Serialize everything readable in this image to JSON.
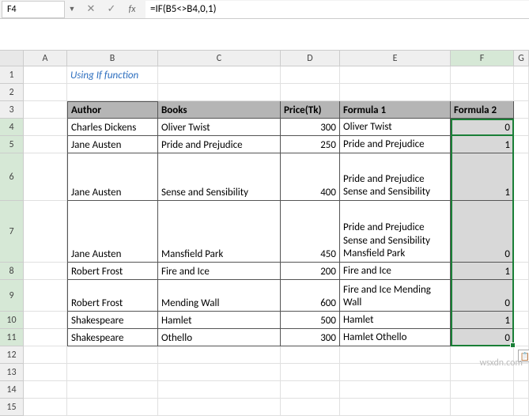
{
  "cell_ref": "F4",
  "formula": "=IF(B5<>B4,0,1)",
  "title": "Using If function",
  "columns": [
    "A",
    "B",
    "C",
    "D",
    "E",
    "F",
    "G"
  ],
  "headers": {
    "author": "Author",
    "books": "Books",
    "price": "Price(Tk)",
    "f1": "Formula 1",
    "f2": "Formula 2"
  },
  "rows": [
    {
      "n": 4,
      "h": 22,
      "author": "Charles Dickens",
      "book": "Oliver Twist",
      "price": 300,
      "f1": "Oliver Twist",
      "f2": 0
    },
    {
      "n": 5,
      "h": 22,
      "author": "Jane Austen",
      "book": "Pride and Prejudice",
      "price": 250,
      "f1": "Pride and Prejudice",
      "f2": 1
    },
    {
      "n": 6,
      "h": 60,
      "author": "Jane Austen",
      "book": "Sense and Sensibility",
      "price": 400,
      "f1": "Pride and Prejudice Sense and Sensibility",
      "f2": 1
    },
    {
      "n": 7,
      "h": 78,
      "author": "Jane Austen",
      "book": "Mansfield Park",
      "price": 450,
      "f1": "Pride and Prejudice Sense and Sensibility Mansfield Park",
      "f2": 0
    },
    {
      "n": 8,
      "h": 22,
      "author": "Robert Frost",
      "book": "Fire and Ice",
      "price": 200,
      "f1": "Fire and Ice",
      "f2": 1
    },
    {
      "n": 9,
      "h": 40,
      "author": "Robert Frost",
      "book": "Mending Wall",
      "price": 600,
      "f1": "Fire and Ice Mending Wall",
      "f2": 0
    },
    {
      "n": 10,
      "h": 22,
      "author": "Shakespeare",
      "book": "Hamlet",
      "price": 500,
      "f1": "Hamlet",
      "f2": 1
    },
    {
      "n": 11,
      "h": 22,
      "author": "Shakespeare",
      "book": "Othello",
      "price": 300,
      "f1": " Hamlet Othello",
      "f2": 0
    }
  ],
  "tail_rows": [
    12,
    13,
    14,
    15
  ],
  "watermark": "wsxdn.com",
  "chart_data": {
    "type": "table",
    "title": "Using If function",
    "columns": [
      "Author",
      "Books",
      "Price(Tk)",
      "Formula 1",
      "Formula 2"
    ],
    "data": [
      [
        "Charles Dickens",
        "Oliver Twist",
        300,
        "Oliver Twist",
        0
      ],
      [
        "Jane Austen",
        "Pride and Prejudice",
        250,
        "Pride and Prejudice",
        1
      ],
      [
        "Jane Austen",
        "Sense and Sensibility",
        400,
        "Pride and Prejudice Sense and Sensibility",
        1
      ],
      [
        "Jane Austen",
        "Mansfield Park",
        450,
        "Pride and Prejudice Sense and Sensibility Mansfield Park",
        0
      ],
      [
        "Robert Frost",
        "Fire and Ice",
        200,
        "Fire and Ice",
        1
      ],
      [
        "Robert Frost",
        "Mending Wall",
        600,
        "Fire and Ice Mending Wall",
        0
      ],
      [
        "Shakespeare",
        "Hamlet",
        500,
        "Hamlet",
        1
      ],
      [
        "Shakespeare",
        "Othello",
        300,
        " Hamlet Othello",
        0
      ]
    ]
  }
}
